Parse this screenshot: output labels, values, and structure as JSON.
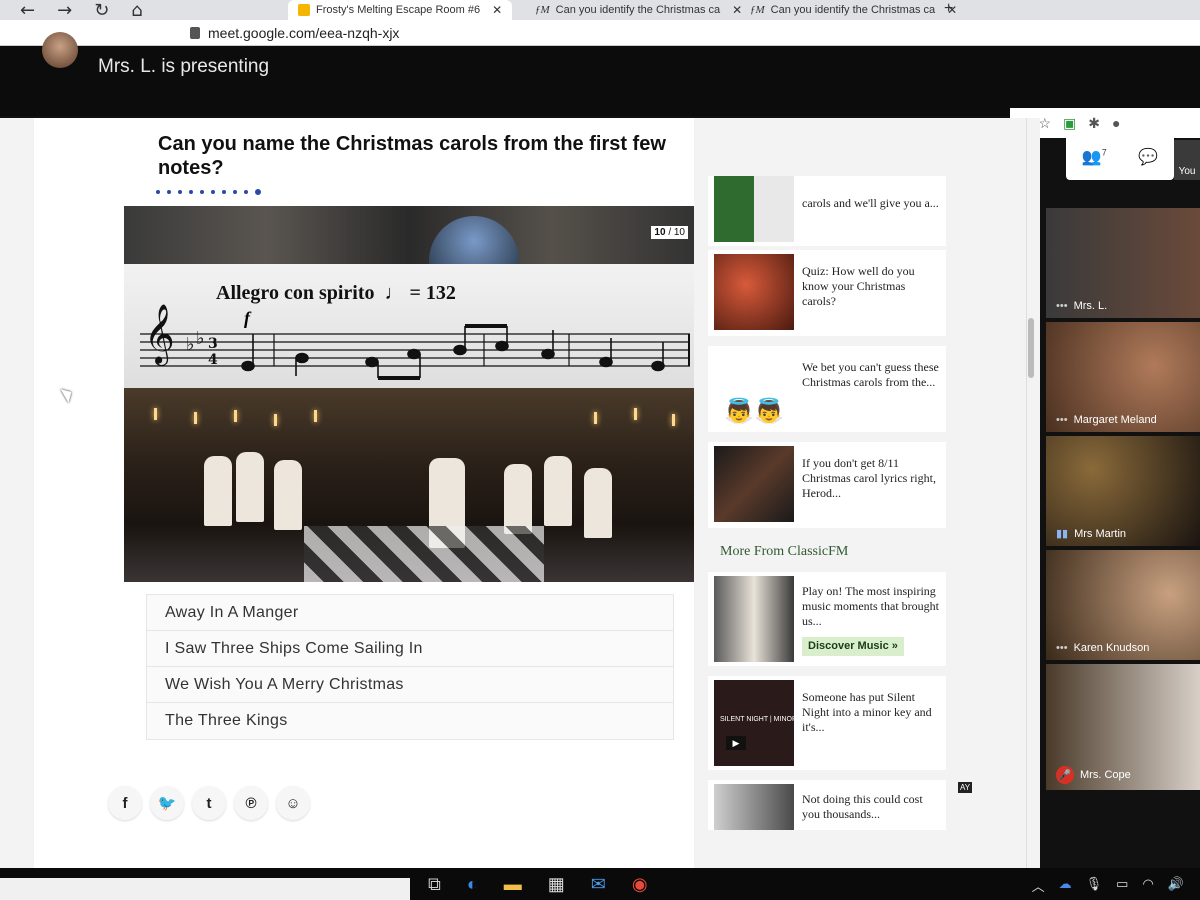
{
  "browser": {
    "url": "meet.google.com/eea-nzqh-xjx",
    "tabs": [
      {
        "title": "Frosty's Melting Escape Room #6"
      },
      {
        "title": "Can you identify the Christmas ca"
      },
      {
        "title": "Can you identify the Christmas ca"
      }
    ]
  },
  "meet": {
    "presenting": "Mrs. L. is presenting",
    "you_label": "You",
    "participant_count": "7",
    "participants": [
      {
        "name": "Mrs. L."
      },
      {
        "name": "Margaret Meland"
      },
      {
        "name": "Mrs Martin"
      },
      {
        "name": "Karen Knudson"
      },
      {
        "name": "Mrs. Cope"
      }
    ]
  },
  "quiz": {
    "title": "Can you name the Christmas carols from the first few notes?",
    "counter_current": "10",
    "counter_total": "/ 10",
    "tempo": "Allegro con spirito",
    "tempo_mark": "♩ = 132",
    "dynamic": "f",
    "answers": [
      "Away In A Manger",
      "I Saw Three Ships Come Sailing In",
      "We Wish You A Merry Christmas",
      "The Three Kings"
    ]
  },
  "sidebar": {
    "cards": [
      {
        "text": "carols and we'll give you a..."
      },
      {
        "text": "Quiz: How well do you know your Christmas carols?"
      },
      {
        "text": "We bet you can't guess these Christmas carols from the..."
      },
      {
        "text": "If you don't get 8/11 Christmas carol lyrics right, Herod..."
      }
    ],
    "more_from": "More From ClassicFM",
    "more_cards": [
      {
        "text": "Play on! The most inspiring music moments that brought us..."
      },
      {
        "text": "Someone has put Silent Night into a minor key and it's..."
      },
      {
        "text": "Not doing this could cost you thousands..."
      }
    ],
    "discover_label": "Discover Music »",
    "thumb_caption": "SILENT NIGHT | MINOR KEY",
    "ad_badge": "AY"
  },
  "icons": {
    "share": [
      "facebook-icon",
      "twitter-icon",
      "tumblr-icon",
      "pinterest-icon",
      "reddit-icon"
    ]
  }
}
